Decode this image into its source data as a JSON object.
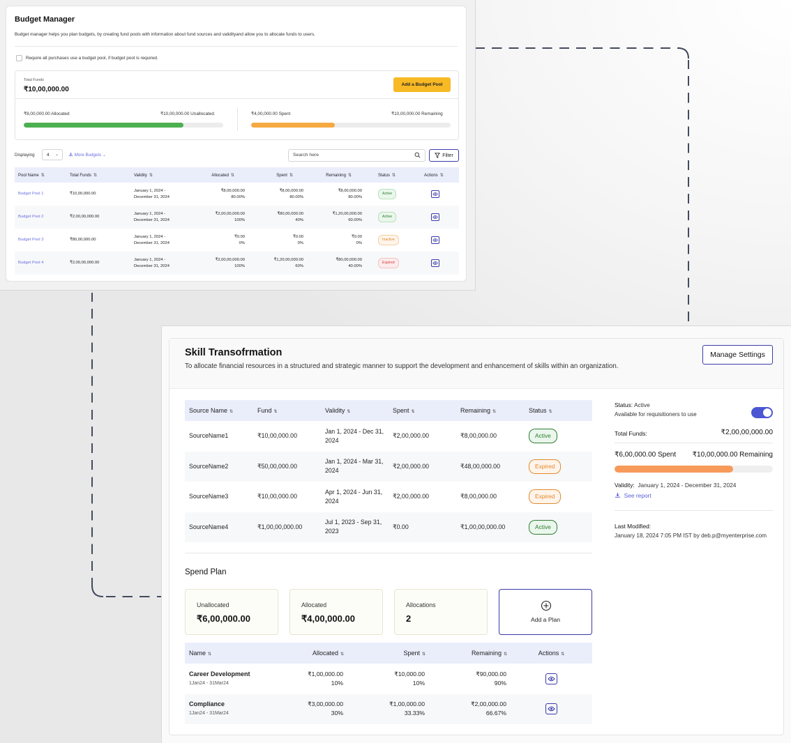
{
  "budget_manager": {
    "title": "Budget Manager",
    "description": "Budget manager helps you plan budgets, by creating fund pools with information about fund sources and validityand allow you to allocate funds to users.",
    "require_checkbox_label": "Require all purchases use a budget pool, if budget pool is required.",
    "require_checked": false,
    "total_funds_label": "Total Funds",
    "total_funds_value": "₹10,00,000.00",
    "add_pool_button": "Add a Budget Pool",
    "allocated_text": "₹8,00,000.00 Allocated",
    "unallocated_text": "₹10,00,000.00 Unallocated",
    "allocated_progress_pct": 80,
    "spent_text": "₹4,00,000.00 Spent",
    "remaining_text": "₹10,00,000.00 Remaining",
    "spent_progress_pct": 42,
    "colors": {
      "allocated_bar": "#4caf50",
      "spent_bar": "#f5a942",
      "accent": "#f7b924"
    },
    "displaying_label": "Displaying",
    "displaying_value": "4",
    "more_budgets_label": "More Budgets",
    "search_placeholder": "Search here",
    "filter_label": "Filter",
    "columns": [
      "Pool Name",
      "Total Funds",
      "Validity",
      "Allocated",
      "Spent",
      "Remaining",
      "Status",
      "Actions"
    ],
    "rows": [
      {
        "name": "Budget Pool 1",
        "total": "₹10,00,000.00",
        "validity_from": "January 1, 2024 -",
        "validity_to": "December 31, 2024",
        "allocated": "₹8,00,000.00",
        "allocated_pct": "80.00%",
        "spent": "₹8,00,000.00",
        "spent_pct": "80.00%",
        "remaining": "₹8,00,000.00",
        "remaining_pct": "80.00%",
        "status": "Active"
      },
      {
        "name": "Budget Pool 2",
        "total": "₹2,00,00,000.00",
        "validity_from": "January 1, 2024 -",
        "validity_to": "December 31, 2024",
        "allocated": "₹2,00,00,000.00",
        "allocated_pct": "100%",
        "spent": "₹80,00,000.00",
        "spent_pct": "40%",
        "remaining": "₹1,20,00,000.00",
        "remaining_pct": "60.00%",
        "status": "Active"
      },
      {
        "name": "Budget Pool 3",
        "total": "₹80,00,000.00",
        "validity_from": "January 1, 2024 -",
        "validity_to": "December 31, 2024",
        "allocated": "₹0.00",
        "allocated_pct": "0%",
        "spent": "₹0.00",
        "spent_pct": "0%",
        "remaining": "₹0.00",
        "remaining_pct": "0%",
        "status": "Inactive"
      },
      {
        "name": "Budget Pool 4",
        "total": "₹2,00,00,000.00",
        "validity_from": "January 1, 2024 -",
        "validity_to": "December 31, 2024",
        "allocated": "₹2,00,00,000.00",
        "allocated_pct": "100%",
        "spent": "₹1,20,00,000.00",
        "spent_pct": "60%",
        "remaining": "₹80,00,000.00",
        "remaining_pct": "40.00%",
        "status": "Expired"
      }
    ]
  },
  "skill": {
    "title": "Skill Transofrmation",
    "description": "To allocate financial resources in a structured and strategic manner to support the development and enhancement of skills within an organization.",
    "manage_button": "Manage Settings",
    "sources_columns": [
      "Source Name",
      "Fund",
      "Validity",
      "Spent",
      "Remaining",
      "Status"
    ],
    "sources": [
      {
        "name": "SourceName1",
        "fund": "₹10,00,000.00",
        "validity_l1": "Jan 1, 2024 - Dec 31,",
        "validity_l2": "2024",
        "spent": "₹2,00,000.00",
        "remaining": "₹8,00,000.00",
        "status": "Active"
      },
      {
        "name": "SourceName2",
        "fund": "₹50,00,000.00",
        "validity_l1": "Jan 1, 2024 - Mar 31,",
        "validity_l2": "2024",
        "spent": "₹2,00,000.00",
        "remaining": "₹48,00,000.00",
        "status": "Expired"
      },
      {
        "name": "SourceName3",
        "fund": "₹10,00,000.00",
        "validity_l1": "Apr 1, 2024 - Jun 31,",
        "validity_l2": "2024",
        "spent": "₹2,00,000.00",
        "remaining": "₹8,00,000.00",
        "status": "Expired"
      },
      {
        "name": "SourceName4",
        "fund": "₹1,00,00,000.00",
        "validity_l1": "Jul 1, 2023 - Sep 31,",
        "validity_l2": "2023",
        "spent": "₹0.00",
        "remaining": "₹1,00,00,000.00",
        "status": "Active"
      }
    ],
    "spend_plan_title": "Spend Plan",
    "kpis": [
      {
        "label": "Unallocated",
        "value": "₹6,00,000.00"
      },
      {
        "label": "Allocated",
        "value": "₹4,00,000.00"
      },
      {
        "label": "Allocations",
        "value": "2"
      }
    ],
    "add_plan_label": "Add a Plan",
    "plan_columns": [
      "Name",
      "Allocated",
      "Spent",
      "Remaining",
      "Actions"
    ],
    "plans": [
      {
        "name": "Career Development",
        "dates": "1Jan24 - 31Mar24",
        "allocated": "₹1,00,000.00",
        "allocated_pct": "10%",
        "spent": "₹10,000.00",
        "spent_pct": "10%",
        "remaining": "₹90,000.00",
        "remaining_pct": "90%"
      },
      {
        "name": "Compliance",
        "dates": "1Jan24 - 31Mar24",
        "allocated": "₹3,00,000.00",
        "allocated_pct": "30%",
        "spent": "₹1,00,000.00",
        "spent_pct": "33.33%",
        "remaining": "₹2,00,000.00",
        "remaining_pct": "66.67%"
      }
    ],
    "side": {
      "status_label": "Status:",
      "status_value": "Active",
      "availability_text": "Available for requisitioners to use",
      "availability_on": true,
      "total_funds_label": "Total Funds:",
      "total_funds_value": "₹2,00,00,000.00",
      "spent_text": "₹6,00,000.00 Spent",
      "remaining_text": "₹10,00,000.00 Remaining",
      "spent_progress_pct": 75,
      "validity_label": "Validity:",
      "validity_value": "January 1, 2024 - December 31, 2024",
      "see_report": "See report",
      "last_modified_label": "Last Modified:",
      "last_modified_value": "January 18, 2024 7:05 PM IST by deb.p@myenterprise.com"
    },
    "colors": {
      "accent": "#3a3aa8",
      "toggle": "#4b56d3",
      "progress": "#f79a5a"
    }
  }
}
